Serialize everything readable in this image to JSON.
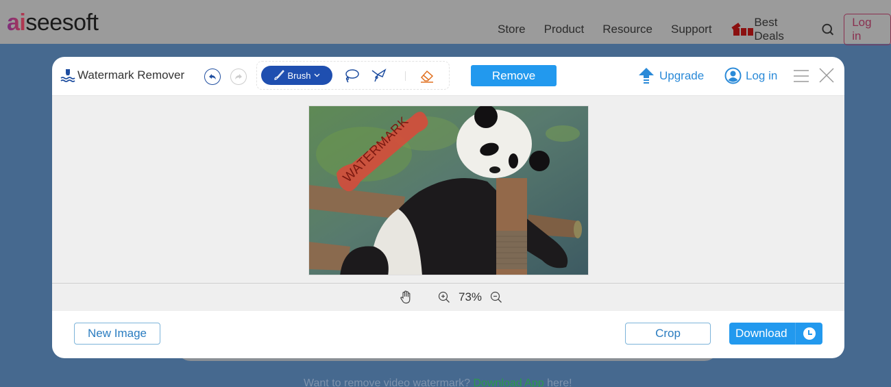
{
  "site": {
    "logo_prefix": "ai",
    "logo_suffix": "seesoft",
    "nav": [
      "Store",
      "Product",
      "Resource",
      "Support"
    ],
    "best_deals": "Best Deals",
    "login": "Log in",
    "icons": {
      "gift": "gift-icon",
      "search": "search-icon"
    }
  },
  "modal": {
    "title": "Watermark Remover",
    "tools": {
      "brush_label": "Brush",
      "remove_label": "Remove"
    },
    "upgrade_label": "Upgrade",
    "login_label": "Log in",
    "image": {
      "watermark_text": "WATERMARK"
    },
    "zoom_level": "73%",
    "footer": {
      "new_image_label": "New Image",
      "crop_label": "Crop",
      "download_label": "Download"
    }
  },
  "bottom": {
    "text_before": "Want to remove video watermark? ",
    "link": "Download App",
    "text_after": " here!"
  },
  "colors": {
    "accent": "#2299ee",
    "brush_active": "#1f4fb0",
    "eraser": "#e07020",
    "site_login": "#8a3050"
  }
}
